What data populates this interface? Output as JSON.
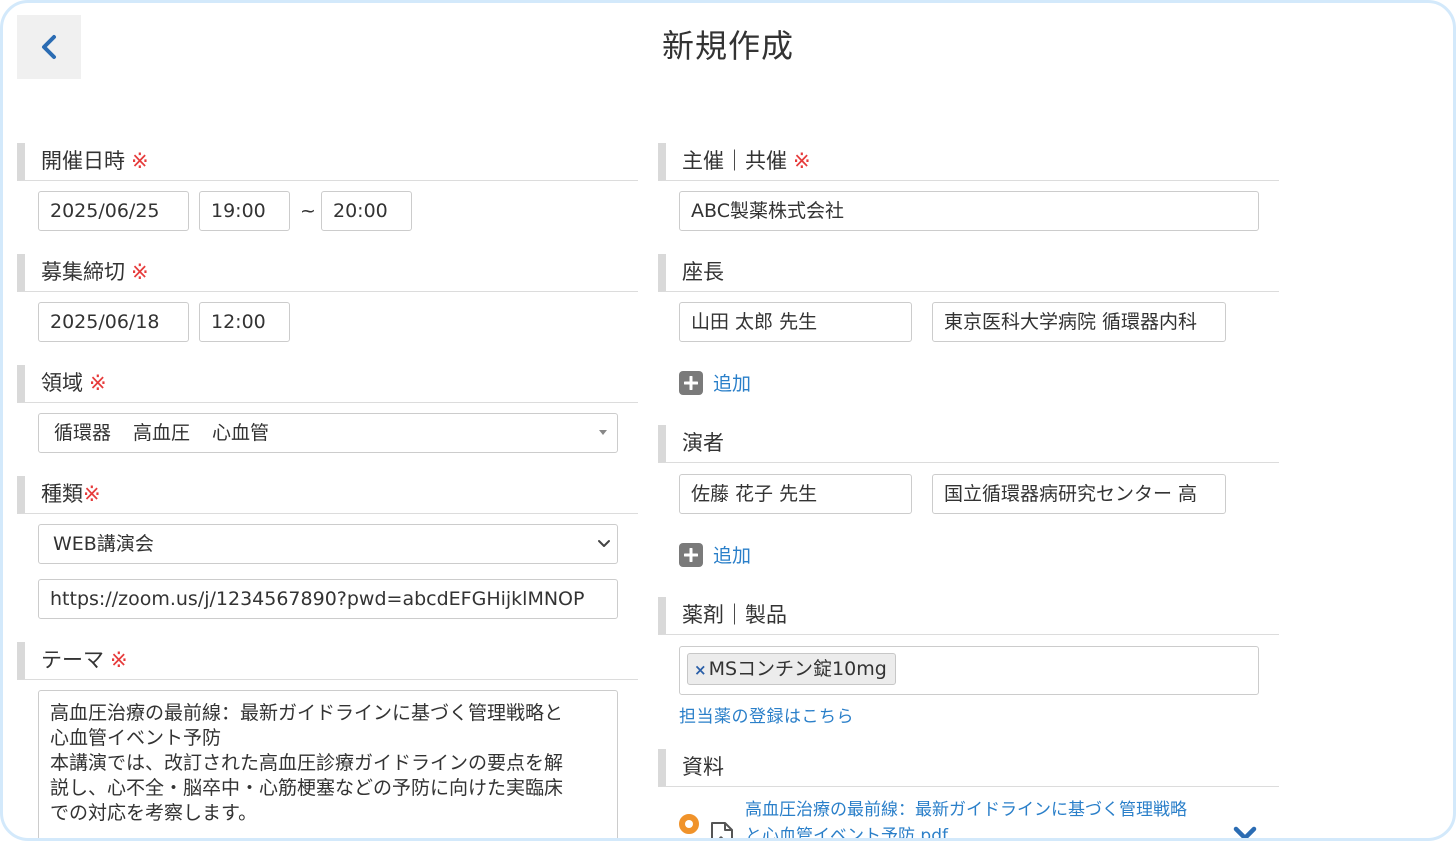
{
  "header": {
    "title": "新規作成"
  },
  "left": {
    "date_section": {
      "label": "開催日時",
      "required_mark": "※"
    },
    "event_date": "2025/06/25",
    "start_time": "19:00",
    "range_separator": "~",
    "end_time": "20:00",
    "deadline_section": {
      "label": "募集締切",
      "required_mark": "※"
    },
    "deadline_date": "2025/06/18",
    "deadline_time": "12:00",
    "field_section": {
      "label": "領域",
      "required_mark": "※"
    },
    "fields": [
      "循環器",
      "高血圧",
      "心血管"
    ],
    "type_section": {
      "label": "種類",
      "required_mark": "※"
    },
    "type_selected": "WEB講演会",
    "url": "https://zoom.us/j/1234567890?pwd=abcdEFGHijklMNOP",
    "theme_section": {
      "label": "テーマ",
      "required_mark": "※"
    },
    "theme_lines": [
      "高血圧治療の最前線：最新ガイドラインに基づく管理戦略と",
      "心血管イベント予防",
      "本講演では、改訂された高血圧診療ガイドラインの要点を解",
      "説し、心不全・脳卒中・心筋梗塞などの予防に向けた実臨床",
      "での対応を考察します。"
    ]
  },
  "right": {
    "organizer_section": {
      "label": "主催｜共催",
      "required_mark": "※"
    },
    "organizer": "ABC製薬株式会社",
    "chair_section": {
      "label": "座長"
    },
    "chair_name": "山田 太郎 先生",
    "chair_affiliation": "東京医科大学病院 循環器内科",
    "chair_add_label": "追加",
    "speaker_section": {
      "label": "演者"
    },
    "speaker_name": "佐藤 花子 先生",
    "speaker_affiliation": "国立循環器病研究センター 高",
    "speaker_add_label": "追加",
    "drug_section": {
      "label": "薬剤｜製品"
    },
    "drug_chip_remove": "×",
    "drug_chip_label": "MSコンチン錠10mg",
    "drug_register_link": "担当薬の登録はこちら",
    "material_section": {
      "label": "資料"
    },
    "material_file_lines": [
      "高血圧治療の最前線：最新ガイドラインに基づく管理戦略",
      "と心血管イベント予防.pdf"
    ]
  },
  "icons": {
    "back": "chevron-left-icon",
    "add": "plus-square-icon",
    "file": "pdf-file-icon",
    "remove": "close-x-icon",
    "radio": "radio-selected-icon"
  },
  "colors": {
    "accent_link": "#2a7fc9",
    "required": "#e63b3b",
    "back_chevron": "#2b6cb3",
    "radio": "#f0932b",
    "frame_border": "#d3e9fb"
  }
}
